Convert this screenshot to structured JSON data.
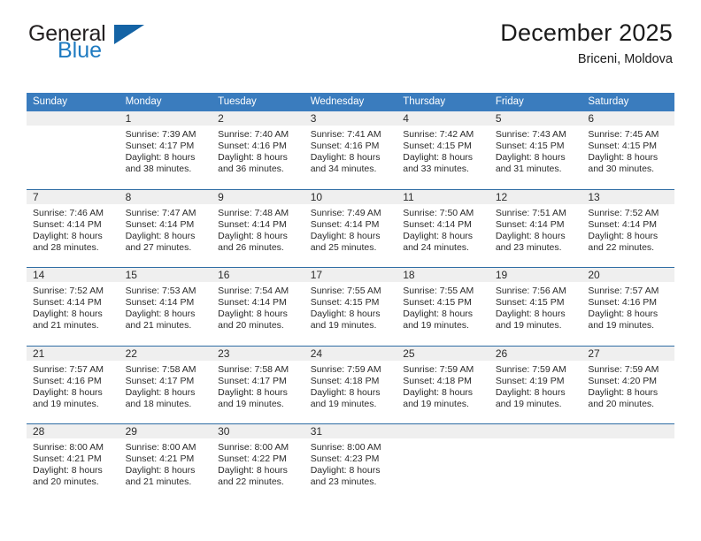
{
  "brand": {
    "name_part1": "General",
    "name_part2": "Blue",
    "flag_icon": "blue-triangle-flag-icon"
  },
  "header": {
    "title": "December 2025",
    "subtitle": "Briceni, Moldova"
  },
  "colors": {
    "header_blue": "#3a7cbe",
    "brand_blue": "#1f7bc1",
    "flag_blue": "#1463a5",
    "row_rule": "#2e6ca4",
    "daynum_band": "#efefef",
    "text": "#2b2b2b"
  },
  "weekdays": [
    "Sunday",
    "Monday",
    "Tuesday",
    "Wednesday",
    "Thursday",
    "Friday",
    "Saturday"
  ],
  "weeks": [
    {
      "days": [
        {
          "num": "",
          "lines": [
            "",
            "",
            "",
            ""
          ]
        },
        {
          "num": "1",
          "lines": [
            "Sunrise: 7:39 AM",
            "Sunset: 4:17 PM",
            "Daylight: 8 hours",
            "and 38 minutes."
          ]
        },
        {
          "num": "2",
          "lines": [
            "Sunrise: 7:40 AM",
            "Sunset: 4:16 PM",
            "Daylight: 8 hours",
            "and 36 minutes."
          ]
        },
        {
          "num": "3",
          "lines": [
            "Sunrise: 7:41 AM",
            "Sunset: 4:16 PM",
            "Daylight: 8 hours",
            "and 34 minutes."
          ]
        },
        {
          "num": "4",
          "lines": [
            "Sunrise: 7:42 AM",
            "Sunset: 4:15 PM",
            "Daylight: 8 hours",
            "and 33 minutes."
          ]
        },
        {
          "num": "5",
          "lines": [
            "Sunrise: 7:43 AM",
            "Sunset: 4:15 PM",
            "Daylight: 8 hours",
            "and 31 minutes."
          ]
        },
        {
          "num": "6",
          "lines": [
            "Sunrise: 7:45 AM",
            "Sunset: 4:15 PM",
            "Daylight: 8 hours",
            "and 30 minutes."
          ]
        }
      ]
    },
    {
      "days": [
        {
          "num": "7",
          "lines": [
            "Sunrise: 7:46 AM",
            "Sunset: 4:14 PM",
            "Daylight: 8 hours",
            "and 28 minutes."
          ]
        },
        {
          "num": "8",
          "lines": [
            "Sunrise: 7:47 AM",
            "Sunset: 4:14 PM",
            "Daylight: 8 hours",
            "and 27 minutes."
          ]
        },
        {
          "num": "9",
          "lines": [
            "Sunrise: 7:48 AM",
            "Sunset: 4:14 PM",
            "Daylight: 8 hours",
            "and 26 minutes."
          ]
        },
        {
          "num": "10",
          "lines": [
            "Sunrise: 7:49 AM",
            "Sunset: 4:14 PM",
            "Daylight: 8 hours",
            "and 25 minutes."
          ]
        },
        {
          "num": "11",
          "lines": [
            "Sunrise: 7:50 AM",
            "Sunset: 4:14 PM",
            "Daylight: 8 hours",
            "and 24 minutes."
          ]
        },
        {
          "num": "12",
          "lines": [
            "Sunrise: 7:51 AM",
            "Sunset: 4:14 PM",
            "Daylight: 8 hours",
            "and 23 minutes."
          ]
        },
        {
          "num": "13",
          "lines": [
            "Sunrise: 7:52 AM",
            "Sunset: 4:14 PM",
            "Daylight: 8 hours",
            "and 22 minutes."
          ]
        }
      ]
    },
    {
      "days": [
        {
          "num": "14",
          "lines": [
            "Sunrise: 7:52 AM",
            "Sunset: 4:14 PM",
            "Daylight: 8 hours",
            "and 21 minutes."
          ]
        },
        {
          "num": "15",
          "lines": [
            "Sunrise: 7:53 AM",
            "Sunset: 4:14 PM",
            "Daylight: 8 hours",
            "and 21 minutes."
          ]
        },
        {
          "num": "16",
          "lines": [
            "Sunrise: 7:54 AM",
            "Sunset: 4:14 PM",
            "Daylight: 8 hours",
            "and 20 minutes."
          ]
        },
        {
          "num": "17",
          "lines": [
            "Sunrise: 7:55 AM",
            "Sunset: 4:15 PM",
            "Daylight: 8 hours",
            "and 19 minutes."
          ]
        },
        {
          "num": "18",
          "lines": [
            "Sunrise: 7:55 AM",
            "Sunset: 4:15 PM",
            "Daylight: 8 hours",
            "and 19 minutes."
          ]
        },
        {
          "num": "19",
          "lines": [
            "Sunrise: 7:56 AM",
            "Sunset: 4:15 PM",
            "Daylight: 8 hours",
            "and 19 minutes."
          ]
        },
        {
          "num": "20",
          "lines": [
            "Sunrise: 7:57 AM",
            "Sunset: 4:16 PM",
            "Daylight: 8 hours",
            "and 19 minutes."
          ]
        }
      ]
    },
    {
      "days": [
        {
          "num": "21",
          "lines": [
            "Sunrise: 7:57 AM",
            "Sunset: 4:16 PM",
            "Daylight: 8 hours",
            "and 19 minutes."
          ]
        },
        {
          "num": "22",
          "lines": [
            "Sunrise: 7:58 AM",
            "Sunset: 4:17 PM",
            "Daylight: 8 hours",
            "and 18 minutes."
          ]
        },
        {
          "num": "23",
          "lines": [
            "Sunrise: 7:58 AM",
            "Sunset: 4:17 PM",
            "Daylight: 8 hours",
            "and 19 minutes."
          ]
        },
        {
          "num": "24",
          "lines": [
            "Sunrise: 7:59 AM",
            "Sunset: 4:18 PM",
            "Daylight: 8 hours",
            "and 19 minutes."
          ]
        },
        {
          "num": "25",
          "lines": [
            "Sunrise: 7:59 AM",
            "Sunset: 4:18 PM",
            "Daylight: 8 hours",
            "and 19 minutes."
          ]
        },
        {
          "num": "26",
          "lines": [
            "Sunrise: 7:59 AM",
            "Sunset: 4:19 PM",
            "Daylight: 8 hours",
            "and 19 minutes."
          ]
        },
        {
          "num": "27",
          "lines": [
            "Sunrise: 7:59 AM",
            "Sunset: 4:20 PM",
            "Daylight: 8 hours",
            "and 20 minutes."
          ]
        }
      ]
    },
    {
      "days": [
        {
          "num": "28",
          "lines": [
            "Sunrise: 8:00 AM",
            "Sunset: 4:21 PM",
            "Daylight: 8 hours",
            "and 20 minutes."
          ]
        },
        {
          "num": "29",
          "lines": [
            "Sunrise: 8:00 AM",
            "Sunset: 4:21 PM",
            "Daylight: 8 hours",
            "and 21 minutes."
          ]
        },
        {
          "num": "30",
          "lines": [
            "Sunrise: 8:00 AM",
            "Sunset: 4:22 PM",
            "Daylight: 8 hours",
            "and 22 minutes."
          ]
        },
        {
          "num": "31",
          "lines": [
            "Sunrise: 8:00 AM",
            "Sunset: 4:23 PM",
            "Daylight: 8 hours",
            "and 23 minutes."
          ]
        },
        {
          "num": "",
          "lines": [
            "",
            "",
            "",
            ""
          ]
        },
        {
          "num": "",
          "lines": [
            "",
            "",
            "",
            ""
          ]
        },
        {
          "num": "",
          "lines": [
            "",
            "",
            "",
            ""
          ]
        }
      ]
    }
  ]
}
